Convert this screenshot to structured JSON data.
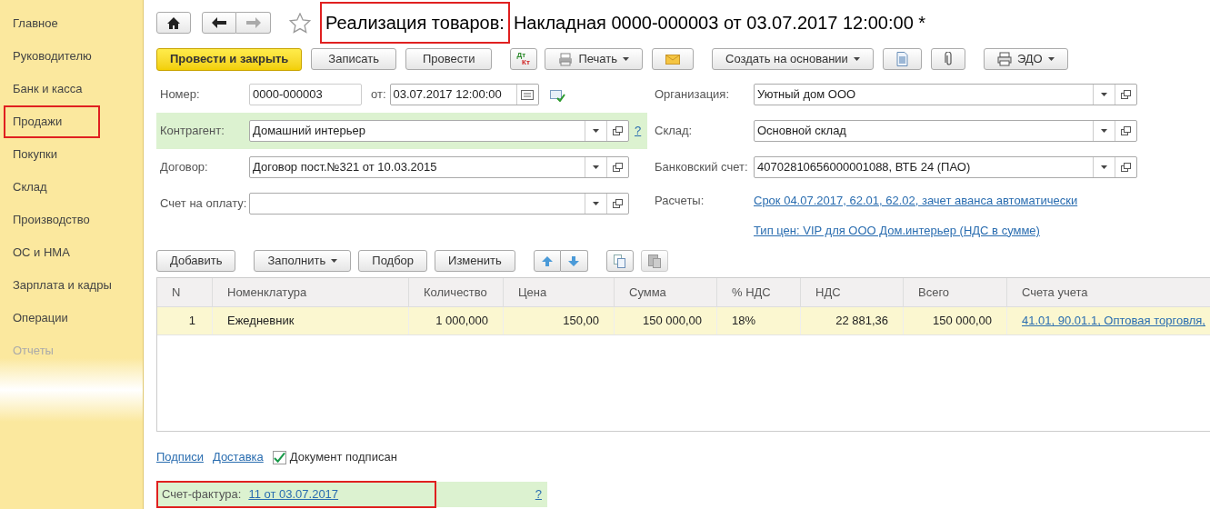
{
  "sidebar": {
    "items": [
      {
        "label": "Главное",
        "selected": false,
        "highlighted": false
      },
      {
        "label": "Руководителю",
        "selected": false,
        "highlighted": false
      },
      {
        "label": "Банк и касса",
        "selected": false,
        "highlighted": false
      },
      {
        "label": "Продажи",
        "selected": false,
        "highlighted": true
      },
      {
        "label": "Покупки",
        "selected": false,
        "highlighted": false
      },
      {
        "label": "Склад",
        "selected": false,
        "highlighted": false
      },
      {
        "label": "Производство",
        "selected": false,
        "highlighted": false
      },
      {
        "label": "ОС и НМА",
        "selected": false,
        "highlighted": false
      },
      {
        "label": "Зарплата и кадры",
        "selected": false,
        "highlighted": false
      },
      {
        "label": "Операции",
        "selected": false,
        "highlighted": false
      },
      {
        "label": "Отчеты",
        "selected": false,
        "highlighted": false
      }
    ]
  },
  "title": {
    "parts": [
      {
        "text": "Реализация товаров:",
        "highlighted": true
      },
      {
        "text": "Накладная 0000-000003 от 03.07.2017 12:00:00 *",
        "highlighted": false
      }
    ]
  },
  "toolbar": {
    "primary": "Провести и закрыть",
    "buttons": [
      "Записать",
      "Провести"
    ],
    "dt_kt": [
      "Дт",
      "Кт"
    ],
    "print": "Печать",
    "create_based": "Создать на основании",
    "edo": "ЭДО"
  },
  "left_fields": [
    {
      "kind": "number",
      "label": "Номер:",
      "value": "0000-000003",
      "date_label": "от:",
      "date": "03.07.2017 12:00:00"
    },
    {
      "kind": "select",
      "label": "Контрагент:",
      "value": "Домашний интерьер",
      "highlighted": true,
      "help": "?"
    },
    {
      "kind": "select",
      "label": "Договор:",
      "value": "Договор пост.№321 от 10.03.2015"
    },
    {
      "kind": "select",
      "label": "Счет на оплату:"
    }
  ],
  "right_fields": [
    {
      "kind": "select",
      "label": "Организация:",
      "value": "Уютный дом ООО"
    },
    {
      "kind": "select",
      "label": "Склад:",
      "value": "Основной склад"
    },
    {
      "kind": "select",
      "label": "Банковский счет:",
      "value": "40702810656000001088, ВТБ 24 (ПАО)"
    },
    {
      "kind": "link",
      "label": "Расчеты:",
      "value": "Срок 04.07.2017, 62.01, 62.02, зачет аванса автоматически"
    },
    {
      "kind": "link",
      "value": "Тип цен: VIP для ООО Дом.интерьер (НДС в сумме)"
    }
  ],
  "table_toolbar": {
    "add": "Добавить",
    "fill": "Заполнить",
    "pick": "Подбор",
    "edit": "Изменить"
  },
  "table": {
    "columns": [
      "N",
      "Номенклатура",
      "Количество",
      "Цена",
      "Сумма",
      "% НДС",
      "НДС",
      "Всего",
      "Счета учета"
    ],
    "rows": [
      {
        "selected": true,
        "cells": [
          "1",
          "Ежедневник",
          "1 000,000",
          "150,00",
          "150 000,00",
          "18%",
          "22 881,36",
          "150 000,00",
          "41.01, 90.01.1, Оптовая торговля,"
        ]
      }
    ]
  },
  "footer": {
    "links": [
      "Подписи",
      "Доставка"
    ],
    "signed": {
      "label": "Документ подписан",
      "checked": true
    },
    "invoice": {
      "label": "Счет-фактура:",
      "value": "11 от 03.07.2017",
      "highlighted": true,
      "help": "?"
    }
  }
}
